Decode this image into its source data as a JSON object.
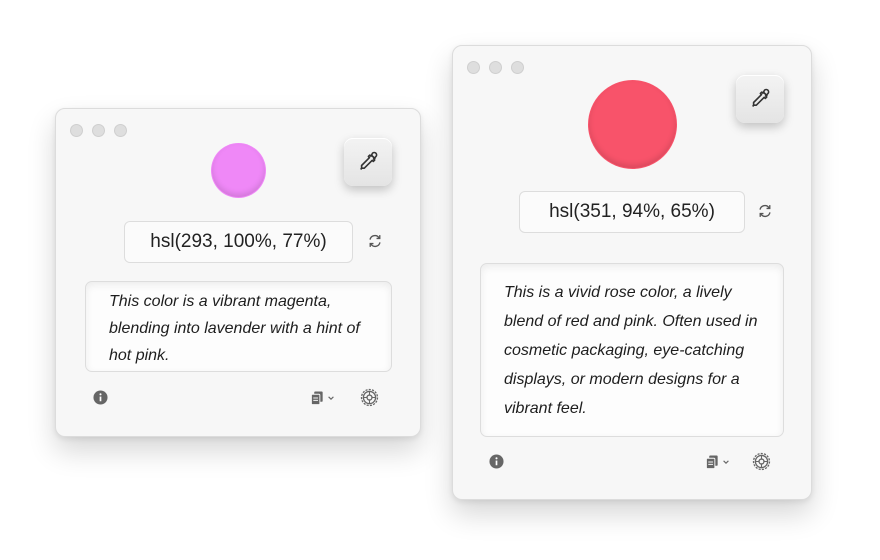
{
  "windows": [
    {
      "swatch_color": "#ef88f7",
      "hsl_value": "hsl(293, 100%, 77%)",
      "description": "This color is a vibrant magenta, blending into lavender with a hint of hot pink."
    },
    {
      "swatch_color": "#f8536a",
      "hsl_value": "hsl(351, 94%, 65%)",
      "description": "This is a vivid rose color, a lively blend of red and pink. Often used in cosmetic packaging, eye-catching displays, or modern designs for a vibrant feel."
    }
  ],
  "icons": {
    "eyedropper": "eyedropper-icon",
    "refresh": "refresh-icon",
    "info": "info-icon",
    "copy": "copy-icon",
    "chevron": "chevron-down-icon",
    "settings": "gear-icon"
  },
  "colors": {
    "window_bg": "#f7f7f7",
    "traffic_light": "#dedede",
    "icon": "#6a6a6a"
  }
}
